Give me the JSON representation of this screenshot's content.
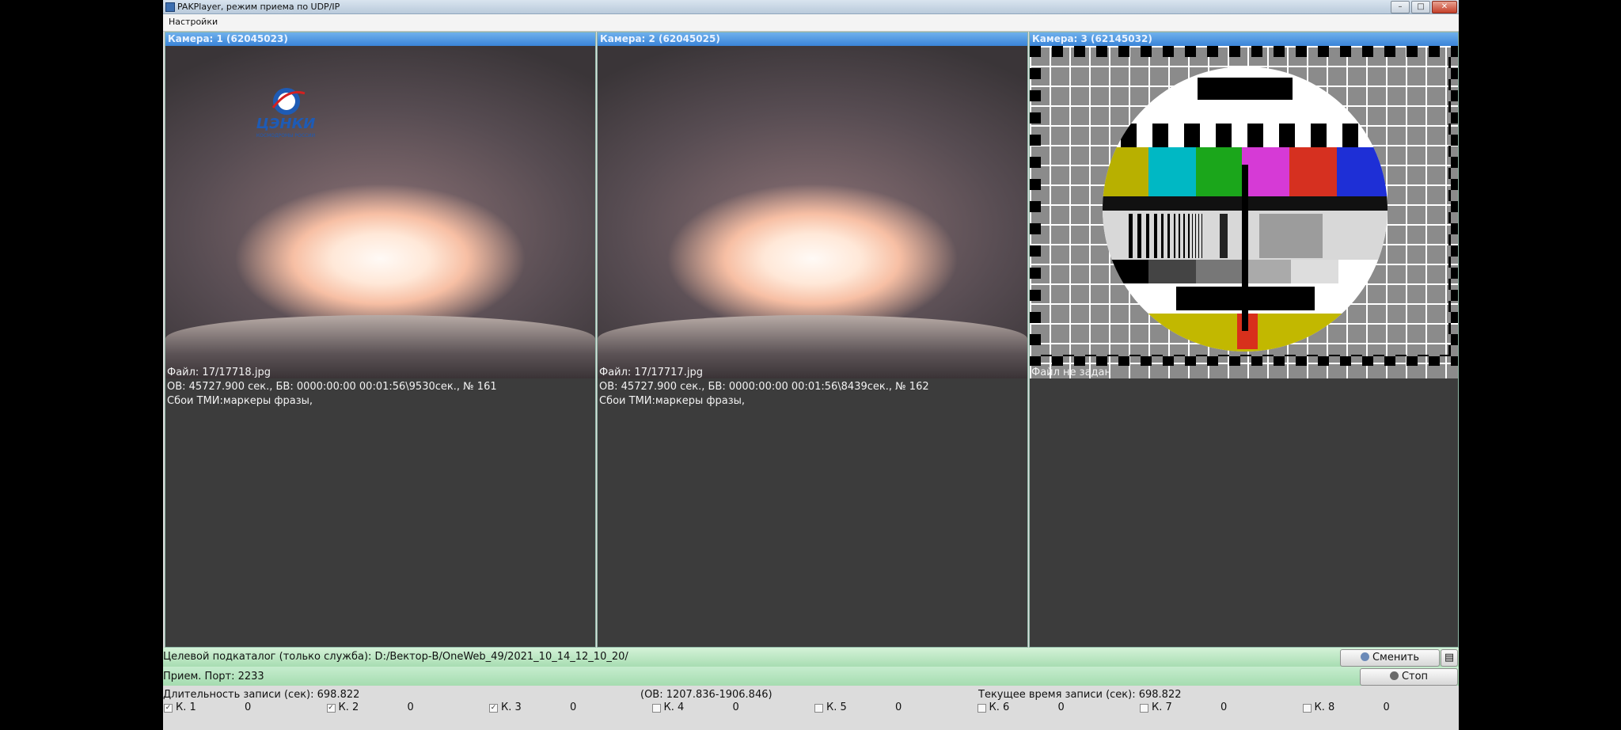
{
  "window": {
    "title": "PAKPlayer, режим приема по UDP/IP"
  },
  "menu": {
    "settings": "Настройки"
  },
  "cameras": [
    {
      "title": "Камера: 1 (62045023)",
      "file": "Файл: 17/17718.jpg",
      "status": "ОВ: 45727.900 сек., БВ: 0000:00:00 00:01:56\\9530сек., № 161",
      "errors": "Сбои ТМИ:маркеры фразы,"
    },
    {
      "title": "Камера: 2 (62045025)",
      "file": "Файл: 17/17717.jpg",
      "status": "ОВ: 45727.900 сек., БВ: 0000:00:00 00:01:56\\8439сек., № 162",
      "errors": "Сбои ТМИ:маркеры фразы,"
    },
    {
      "title": "Камера: 3 (62145032)",
      "file": "Файл не задан"
    }
  ],
  "logo": {
    "text": "ЦЭНКИ",
    "subtext": "КОСМОДРОМЫ РОССИИ"
  },
  "bottom": {
    "target_dir": "Целевой подкаталог (только служба): D:/Вектор-В/OneWeb_49/2021_10_14_12_10_20/",
    "change_button": "Сменить",
    "port": "Прием. Порт: 2233",
    "stop_button": "Стоп",
    "duration": "Длительность записи (сек): 698.822",
    "ov_range": "(ОВ: 1207.836-1906.846)",
    "current_time": "Текущее время записи (сек): 698.822"
  },
  "channels": [
    {
      "label": "К. 1",
      "count": "0",
      "checked": true
    },
    {
      "label": "К. 2",
      "count": "0",
      "checked": true
    },
    {
      "label": "К. 3",
      "count": "0",
      "checked": true
    },
    {
      "label": "К. 4",
      "count": "0",
      "checked": false
    },
    {
      "label": "К. 5",
      "count": "0",
      "checked": false
    },
    {
      "label": "К. 6",
      "count": "0",
      "checked": false
    },
    {
      "label": "К. 7",
      "count": "0",
      "checked": false
    },
    {
      "label": "К. 8",
      "count": "0",
      "checked": false
    }
  ],
  "colors": {
    "title_bar": "#3a84d8",
    "panel": "#3c3c3c",
    "status_bar": "#a8ddb2"
  }
}
